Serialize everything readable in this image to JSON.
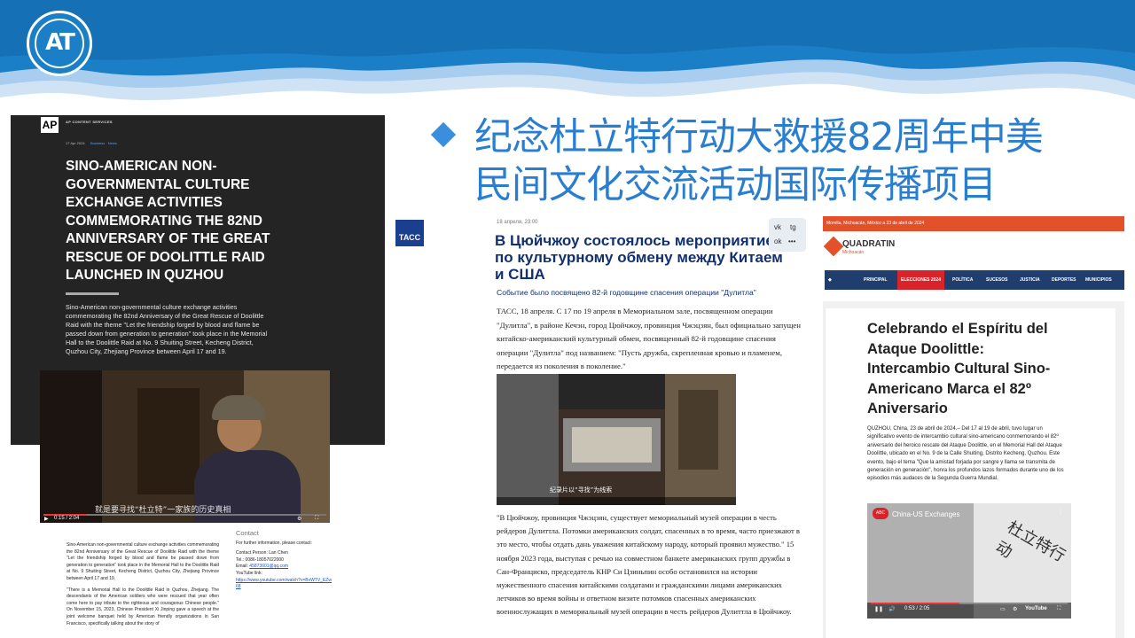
{
  "slide": {
    "title_line1": "纪念杜立特行动大救援82周年中美",
    "title_line2": "民间文化交流活动国际传播项目"
  },
  "colors": {
    "wave_dark": "#1a7fc6",
    "wave_light": "#cfe3f5",
    "title_blue": "#2a7ecf",
    "tass_blue": "#12306f",
    "quadratin_orange": "#e2512a",
    "quadratin_nav": "#1f3e6d",
    "active_red": "#d8232a"
  },
  "ap": {
    "logo": "AP",
    "brand": "AP CONTENT SERVICES",
    "date": "17 Apr 2024",
    "tags": "Business · News",
    "headline": "SINO-AMERICAN NON-GOVERNMENTAL CULTURE EXCHANGE ACTIVITIES COMMEMORATING THE 82ND ANNIVERSARY OF THE GREAT RESCUE OF DOOLITTLE RAID LAUNCHED IN QUZHOU",
    "summary": "Sino-American non-governmental culture exchange activities commemorating the 82nd Anniversary of the Great Rescue of Doolittle Raid with the theme \"Let the friendship forged by blood and flame be passed down from generation to generation\" took place in the Memorial Hall to the Doolittle Raid at No. 9 Shuiting Street, Kecheng District, Quzhou City, Zhejiang Province between April 17 and 19.",
    "video_caption": "就是要寻找“杜立特”一家族的历史真相",
    "video_time": "0:15 / 2:04",
    "body_p1": "Sino-American non-governmental culture exchange activities commemorating the 82nd Anniversary of the Great Rescue of Doolittle Raid with the theme \"Let the friendship forged by blood and flame be passed down from generation to generation\" took place in the Memorial Hall to the Doolittle Raid at No. 9 Shuiting Street, Kecheng District, Quzhou City, Zhejiang Province between April 17 and 19.",
    "body_p2": "\"There is a Memorial Hall to the Doolittle Raid in Quzhou, Zhejiang. The descendants of the American soldiers who were rescued that year often come here to pay tribute to the righteous and courageous Chinese people.\" On November 15, 2023, Chinese President Xi Jinping gave a speech at the joint welcome banquet held by American friendly organizations in San Francisco, specifically talking about the story of",
    "contact_title": "Contact",
    "contact_intro": "For further information, please contact:",
    "contact_person": "Contact Person: Lan Chen",
    "contact_tel": "Tel.: 0086-18057022000",
    "contact_email_label": "Email:",
    "contact_email": "45873601@qq.com",
    "contact_youtube_label": "YouTube link:",
    "contact_youtube": "https://www.youtube.com/watch?v=BvWTV_EZw68"
  },
  "tass": {
    "logo": "ТАСС",
    "time": "18 апреля, 23:00",
    "headline": "В Цюйчжоу состоялось мероприятие по культурному обмену между Китаем и США",
    "subheadline": "Событие было посвящено 82-й годовщине спасения операции \"Дулитла\"",
    "share_vk": "vk",
    "share_tg": "tg",
    "share_ok": "ok",
    "share_more": "•••",
    "paragraph1": "ТАСС, 18 апреля. С 17 по 19 апреля в Мемориальном зале, посвященном операции \"Дулитла\", в районе Кечэн, город Цюйчжоу, провинция Чжэцзян, был официально запущен китайско-американский культурный обмен, посвященный 82-й годовщине спасения операции \"Дулитла\" под названием: \"Пусть дружба, скрепленная кровью и пламенем, передается из поколения в поколение.\"",
    "video_caption": "纪录片以“寻找”为线索",
    "paragraph2": "\"В Цюйчжоу, провинция Чжэцзян, существует мемориальный музей операции в честь рейдеров Дулиттла. Потомки американских солдат, спасенных в то время, часто приезжают в это место, чтобы отдать дань уважения китайскому народу, который проявил мужество.\" 15 ноября 2023 года, выступая с речью на совместном банкете американских групп дружбы в Сан-Франциско, председатель КНР Си Цзиньпин особо остановился на истории мужественного спасения китайскими солдатами и гражданскими лицами американских летчиков во время войны и ответном визите потомков спасенных американских военнослужащих в мемориальный музей операции в честь рейдеров Дулиттла в Цюйчжоу."
  },
  "quadratin": {
    "topbar": "Morelia, Michoacán, México a 23 de abril de 2024",
    "logo": "QUADRATIN",
    "logo_sub": "Michoacán",
    "nav": [
      "PRINCIPAL",
      "ELECCIONES 2024",
      "POLÍTICA",
      "SUCESOS",
      "JUSTICIA",
      "DEPORTES",
      "MUNICIPIOS"
    ],
    "headline": "Celebrando el Espíritu del Ataque Doolittle: Intercambio Cultural Sino-Americano Marca el 82º Aniversario",
    "body": "QUZHOU, China, 23 de abril de 2024.– Del 17 al 19 de abril, tuvo lugar un significativo evento de intercambio cultural sino-americano conmemorando el 82º aniversario del heroico rescate del Ataque Doolittle, en el Memorial Hall del Ataque Doolittle, ubicado en el No. 9 de la Calle Shuiting, Distrito Kecheng, Quzhou. Este evento, bajo el tema \"Que la amistad forjada por sangre y llama se transmita de generación en generación\", honra los profundos lazos formados durante uno de los episodios más audaces de la Segunda Guerra Mundial.",
    "video_channel_logo": "ABC",
    "video_title": "China-US Exchanges",
    "video_time": "0:53 / 2:05",
    "video_brand": "YouTube",
    "video_overlay_text": "杜立特行动"
  }
}
